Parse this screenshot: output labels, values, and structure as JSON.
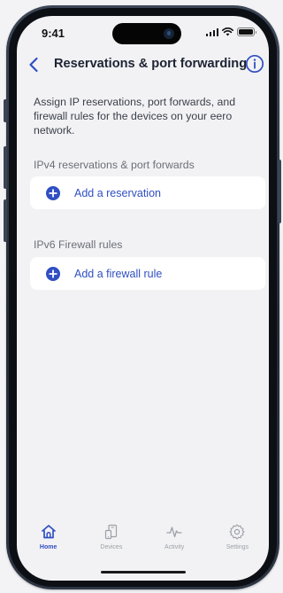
{
  "status_bar": {
    "time": "9:41",
    "icons": [
      "signal-icon",
      "wifi-icon",
      "battery-icon"
    ]
  },
  "nav": {
    "back_icon": "chevron-left-icon",
    "title": "Reservations & port forwarding",
    "info_icon": "info-icon"
  },
  "description": "Assign IP reservations, port forwards, and firewall rules for the devices on your eero network.",
  "sections": {
    "ipv4": {
      "header": "IPv4 reservations & port forwards",
      "action_label": "Add a reservation",
      "action_icon": "plus-circle-icon"
    },
    "ipv6": {
      "header": "IPv6 Firewall rules",
      "action_label": "Add a firewall rule",
      "action_icon": "plus-circle-icon"
    }
  },
  "tabs": [
    {
      "label": "Home",
      "icon": "home-icon",
      "active": true
    },
    {
      "label": "Devices",
      "icon": "devices-icon",
      "active": false
    },
    {
      "label": "Activity",
      "icon": "activity-icon",
      "active": false
    },
    {
      "label": "Settings",
      "icon": "settings-icon",
      "active": false
    }
  ],
  "colors": {
    "accent": "#2f4fc2",
    "title_text": "#1c2333",
    "body_text": "#3a3f4a",
    "section_header_text": "#6b6f78",
    "inactive_tab": "#9ca0a8",
    "screen_background": "#f2f2f4",
    "card_background": "#ffffff"
  }
}
